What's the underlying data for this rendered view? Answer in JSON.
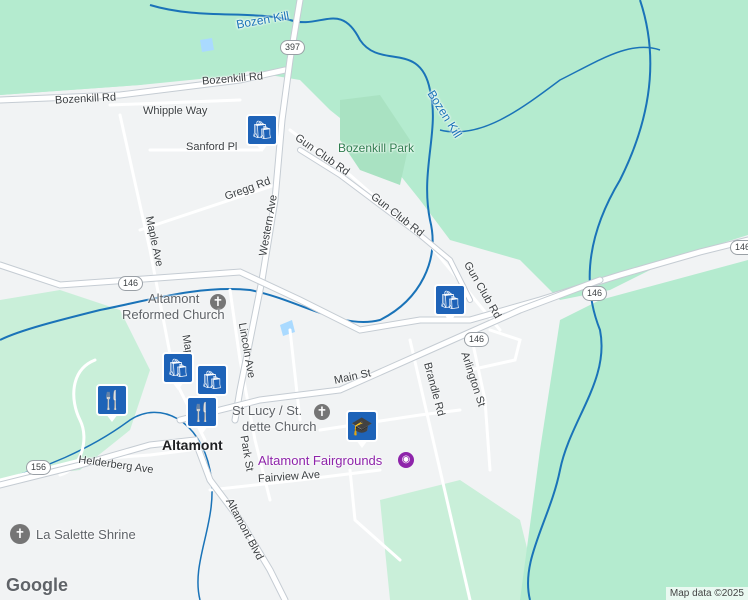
{
  "map": {
    "water_labels": [
      "Bozen Kill",
      "Bozen Kill"
    ],
    "park_label": "Bozenkill Park",
    "route_shields": [
      "397",
      "146",
      "146",
      "146",
      "146",
      "156"
    ],
    "road_labels": {
      "bozenkill_rd_1": "Bozenkill Rd",
      "bozenkill_rd_2": "Bozenkill Rd",
      "whipple_way": "Whipple Way",
      "sanford_pl": "Sanford Pl",
      "gregg_rd": "Gregg Rd",
      "gun_club_rd_1": "Gun Club Rd",
      "gun_club_rd_2": "Gun Club Rd",
      "gun_club_rd_3": "Gun Club Rd",
      "western_ave": "Western Ave",
      "maple_ave_1": "Maple Ave",
      "maple_ave_2": "Map",
      "lincoln_ave": "Lincoln Ave",
      "park_st": "Park St",
      "main_st": "Main St",
      "brandle_rd": "Brandle Rd",
      "arlington_st": "Arlington St",
      "helderberg_ave": "Helderberg Ave",
      "fairview_ave": "Fairview Ave",
      "altamont_blvd": "Altamont Blvd"
    },
    "places": {
      "reformed_church_line1": "Altamont",
      "reformed_church_line2": "Reformed Church",
      "st_lucy_line1": "St Lucy / St.",
      "st_lucy_line2": "dette Church",
      "town": "Altamont",
      "fairgrounds": "Altamont Fairgrounds",
      "shrine": "La Salette Shrine"
    },
    "markers": [
      "shopping-bag",
      "shopping-bag",
      "shopping-bag",
      "shopping-bag",
      "restaurant",
      "restaurant",
      "school"
    ],
    "colors": {
      "land": "#f1f3f4",
      "green": "#b4ebcf",
      "water": "#aadaff",
      "road": "#ffffff",
      "highway": "#c5ccd3",
      "pin": "#1e63b8",
      "fair": "#8e24aa"
    }
  },
  "footer": {
    "logo": "Google",
    "attribution": "Map data ©2025"
  }
}
